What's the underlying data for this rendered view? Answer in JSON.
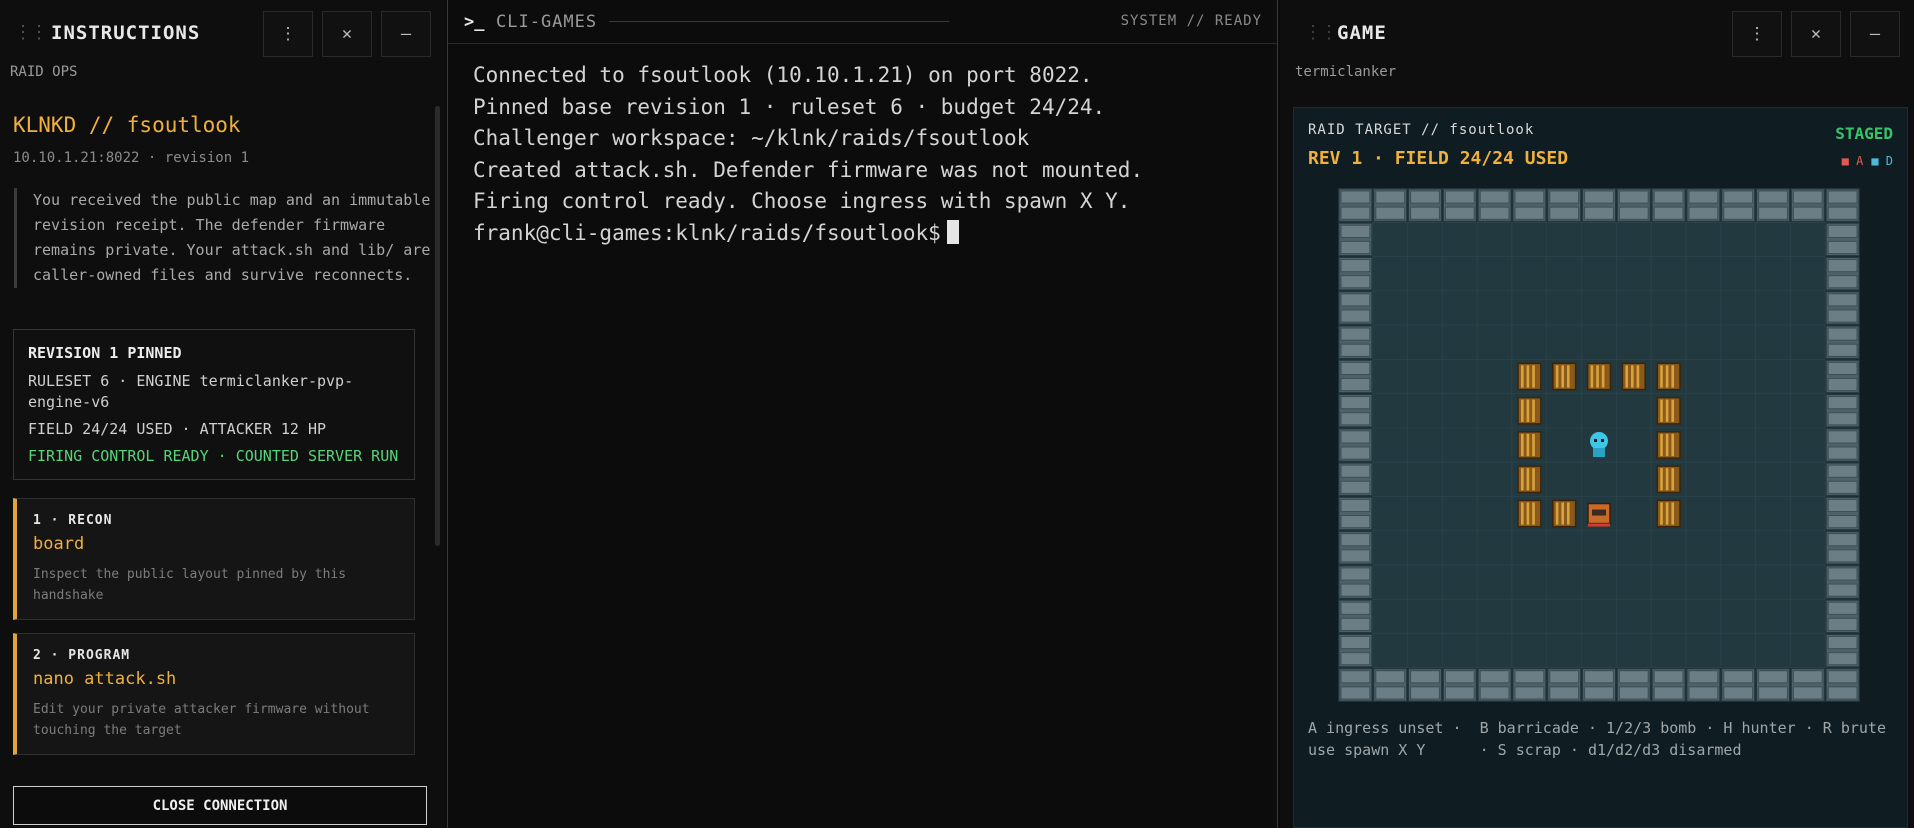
{
  "left": {
    "title": "INSTRUCTIONS",
    "subtitle": "RAID OPS",
    "raid_title": "KLNKD // fsoutlook",
    "raid_meta": "10.10.1.21:8022 · revision 1",
    "intro": "You received the public map and an immutable revision receipt. The defender firmware remains private. Your attack.sh and lib/ are caller-owned files and survive reconnects.",
    "revision_box": {
      "heading": "REVISION 1 PINNED",
      "line1": "RULESET 6 · ENGINE termiclanker-pvp-engine-v6",
      "line2": "FIELD 24/24 USED · ATTACKER 12 HP",
      "status": "FIRING CONTROL READY · COUNTED SERVER RUN"
    },
    "steps": [
      {
        "number": "1 · RECON",
        "command": "board",
        "desc": "Inspect the public layout pinned by this handshake"
      },
      {
        "number": "2 · PROGRAM",
        "command": "nano attack.sh",
        "desc": "Edit your private attacker firmware without touching the target"
      }
    ],
    "close_label": "CLOSE CONNECTION",
    "buttons": {
      "menu": "⋮",
      "close": "✕",
      "minimize": "—"
    }
  },
  "terminal": {
    "icon": ">_",
    "title": "CLI-GAMES",
    "status": "SYSTEM // READY",
    "lines": [
      "Connected to fsoutlook (10.10.1.21) on port 8022.",
      "Pinned base revision 1 · ruleset 6 · budget 24/24.",
      "Challenger workspace: ~/klnk/raids/fsoutlook",
      "Created attack.sh. Defender firmware was not mounted.",
      "Firing control ready. Choose ingress with spawn X Y."
    ],
    "prompt": "frank@cli-games:klnk/raids/fsoutlook$"
  },
  "game": {
    "title": "GAME",
    "subtitle": "termiclanker",
    "raid_target": "RAID TARGET // fsoutlook",
    "rev_line": "REV 1 · FIELD 24/24 USED",
    "state": "STAGED",
    "legend_attacker": "A",
    "legend_defender": "D",
    "hint": "A ingress unset ·  B barricade · 1/2/3 bomb · H hunter · R brute\nuse spawn X Y      · S scrap · d1/d2/d3 disarmed",
    "grid": {
      "cols": 15,
      "rows": 15,
      "barricades": [
        [
          5,
          5
        ],
        [
          6,
          5
        ],
        [
          7,
          5
        ],
        [
          8,
          5
        ],
        [
          9,
          5
        ],
        [
          5,
          6
        ],
        [
          9,
          6
        ],
        [
          5,
          7
        ],
        [
          9,
          7
        ],
        [
          5,
          8
        ],
        [
          9,
          8
        ],
        [
          5,
          9
        ],
        [
          6,
          9
        ],
        [
          9,
          9
        ]
      ],
      "defender_core": [
        7,
        7
      ],
      "brute": [
        7,
        9
      ]
    },
    "buttons": {
      "menu": "⋮",
      "close": "✕",
      "minimize": "—"
    }
  },
  "colors": {
    "accent": "#efb03f",
    "ok": "#39c46a",
    "board_floor": "#253b43",
    "wall": "#5d6f76"
  }
}
